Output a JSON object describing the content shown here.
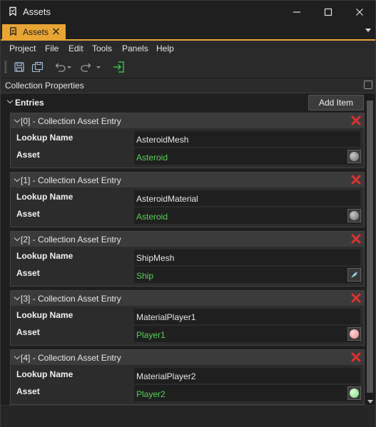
{
  "window": {
    "title": "Assets"
  },
  "doc_tab": {
    "label": "Assets"
  },
  "menu": [
    {
      "label": "Project"
    },
    {
      "label": "File"
    },
    {
      "label": "Edit"
    },
    {
      "label": "Tools"
    },
    {
      "label": "Panels"
    },
    {
      "label": "Help"
    }
  ],
  "panel": {
    "title": "Collection Properties",
    "entries_label": "Entries",
    "add_item_label": "Add Item"
  },
  "entries": [
    {
      "header": "[0] - Collection Asset Entry",
      "lookup_label": "Lookup Name",
      "asset_label": "Asset",
      "lookup_value": "AsteroidMesh",
      "asset_value": "Asteroid",
      "thumb_color": "#8a8a8a"
    },
    {
      "header": "[1] - Collection Asset Entry",
      "lookup_label": "Lookup Name",
      "asset_label": "Asset",
      "lookup_value": "AsteroidMaterial",
      "asset_value": "Asteroid",
      "thumb_color": "#8a8a8a"
    },
    {
      "header": "[2] - Collection Asset Entry",
      "lookup_label": "Lookup Name",
      "asset_label": "Asset",
      "lookup_value": "ShipMesh",
      "asset_value": "Ship",
      "thumb_color": "#9ad8f0"
    },
    {
      "header": "[3] - Collection Asset Entry",
      "lookup_label": "Lookup Name",
      "asset_label": "Asset",
      "lookup_value": "MaterialPlayer1",
      "asset_value": "Player1",
      "thumb_color": "#f0a8a8"
    },
    {
      "header": "[4] - Collection Asset Entry",
      "lookup_label": "Lookup Name",
      "asset_label": "Asset",
      "lookup_value": "MaterialPlayer2",
      "asset_value": "Player2",
      "thumb_color": "#a8e8a8"
    }
  ],
  "colors": {
    "accent": "#e8a534",
    "asset_link": "#5ad05a",
    "delete": "#e03030"
  }
}
